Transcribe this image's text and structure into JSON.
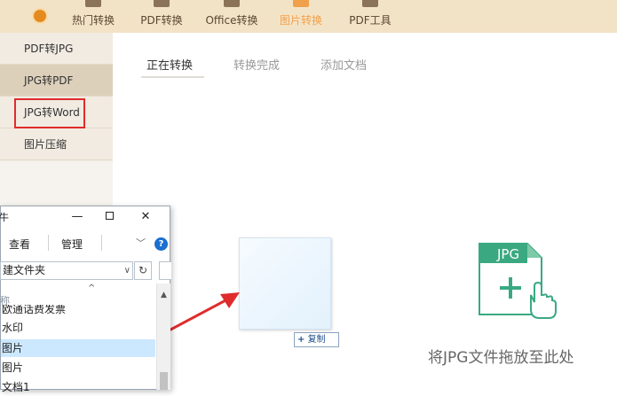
{
  "topnav": {
    "items": [
      {
        "label": "热门转换",
        "icon": "star-icon"
      },
      {
        "label": "PDF转换",
        "icon": "pdf-icon"
      },
      {
        "label": "Office转换",
        "icon": "office-icon"
      },
      {
        "label": "图片转换",
        "icon": "image-icon",
        "active": true
      },
      {
        "label": "PDF工具",
        "icon": "toolbox-icon"
      }
    ],
    "active_color": "#f3a04b",
    "bar_color": "#f3e3c6"
  },
  "sidebar": {
    "items": [
      {
        "label": "PDF转JPG"
      },
      {
        "label": "JPG转PDF",
        "selected": true
      },
      {
        "label": "JPG转Word"
      },
      {
        "label": "图片压缩"
      }
    ],
    "highlight_color": "#e02b2b"
  },
  "tabs": {
    "converting": "正在转换",
    "done": "转换完成",
    "add": "添加文档"
  },
  "drag": {
    "copy_label": "复制"
  },
  "dropzone": {
    "icon_text": "JPG",
    "hint": "将JPG文件拖放至此处",
    "icon_color": "#3aa981"
  },
  "explorer": {
    "title_fragment": "牛",
    "ribbon": {
      "view": "查看",
      "manage": "管理"
    },
    "address": "建文件夹",
    "column_fragment": "称",
    "files": [
      {
        "name": "欧通话费发票"
      },
      {
        "name": "水印"
      },
      {
        "name": "图片",
        "selected": true
      },
      {
        "name": "图片"
      },
      {
        "name": "文档1"
      }
    ]
  }
}
